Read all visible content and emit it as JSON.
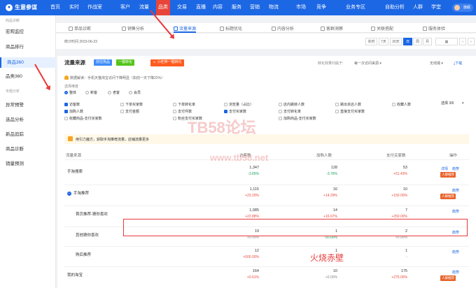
{
  "topnav": {
    "logo": "生意参谋",
    "items": [
      "首页",
      "实时",
      "作战室",
      "客户",
      "流量",
      "品类",
      "交易",
      "直播",
      "内容",
      "服务",
      "营销",
      "物流",
      "市场",
      "竞争",
      "业务专区",
      "自助分析",
      "人群",
      "学堂"
    ],
    "active": "品类",
    "user": "旗舰"
  },
  "sidebar": {
    "group1": "商品诊断",
    "items1": [
      "宏观监控",
      "商品排行",
      "商品360",
      "品类360"
    ],
    "active": "商品360",
    "group2": "专题分析",
    "items2": [
      "异常预警",
      "选品分析",
      "新品追踪",
      "商品诊断",
      "销量预测"
    ]
  },
  "tabs": [
    "单品诊断",
    "销售分析",
    "流量来源",
    "标题优化",
    "内容分析",
    "客群洞察",
    "关联搭配",
    "服务体验"
  ],
  "active_tab": "流量来源",
  "statbar": {
    "time": "统计时间 2023-06-23",
    "periods": [
      "实时",
      "7天",
      "30天",
      "日",
      "周",
      "月"
    ],
    "active_period": "日"
  },
  "section": {
    "title": "流量来源",
    "btn_blue": "前往热品",
    "btn_green": "一键转化",
    "btn_orange": "小旺神一键转化",
    "effect_label": "转化效果归属于:",
    "effect_value": "每一次访问来源",
    "device": "无线端",
    "download": "下载"
  },
  "notice": "数据解读：手机天猫淘宝访问下降明显（如前一天下降22%）",
  "dimension_label": "选择维度",
  "dimension_options": [
    "整体",
    "新客",
    "老客",
    "会员"
  ],
  "dimension_selected": "整体",
  "metrics_select_count": "选择 3/6",
  "metrics": [
    {
      "label": "访客数",
      "on": true
    },
    {
      "label": "下单买家数",
      "on": false
    },
    {
      "label": "下单转化率",
      "on": false
    },
    {
      "label": "浏览量（占比）",
      "on": false
    },
    {
      "label": "店内跳转人数",
      "on": false
    },
    {
      "label": "跳出本店人数",
      "on": false
    },
    {
      "label": "收藏人数",
      "on": false
    },
    {
      "label": "加购人数",
      "on": true
    },
    {
      "label": "支付金额",
      "on": false
    },
    {
      "label": "支付件数",
      "on": false
    },
    {
      "label": "支付买家数",
      "on": true
    },
    {
      "label": "支付转化率",
      "on": false
    },
    {
      "label": "直接支付买家数",
      "on": false
    },
    {
      "label": "收藏商品-支付买家数",
      "on": false
    },
    {
      "label": "粉丝支付买家数",
      "on": false
    },
    {
      "label": "加购商品-支付买家数",
      "on": false
    }
  ],
  "banner": "用引力魔方，获取手淘推荐流量，店铺流量更多",
  "table": {
    "headers": [
      "流量来源",
      "访客数",
      "加购人数",
      "支付买家数",
      "操作"
    ],
    "rows": [
      {
        "name": "手淘搜索",
        "v1": "1,347",
        "c1": "-3.65%",
        "v2": "128",
        "c2": "-3.76%",
        "v3": "53",
        "c3": "+51.43%",
        "act1": "详情",
        "act2": "趋势",
        "badge": "人群推荐"
      },
      {
        "name": "手淘推荐",
        "v1": "1,115",
        "c1": "+23.20%",
        "v2": "16",
        "c2": "+14.29%",
        "v3": "10",
        "c3": "+150.00%",
        "act1": "",
        "act2": "趋势",
        "badge": "人群推荐"
      },
      {
        "name": "首页推荐-猜你喜欢",
        "v1": "1,085",
        "c1": "+22.88%",
        "v2": "14",
        "c2": "+16.67%",
        "v3": "7",
        "c3": "+250.00%",
        "act1": "",
        "act2": "趋势",
        "badge": ""
      },
      {
        "name": "其他猜你喜欢",
        "v1": "19",
        "c1": "+0.00%",
        "v2": "1",
        "c2": "-50.00%",
        "v3": "2",
        "c3": "+0.00%",
        "act1": "",
        "act2": "趋势",
        "badge": ""
      },
      {
        "name": "购后推荐",
        "v1": "12",
        "c1": "+500.00%",
        "v2": "1",
        "c2": "-",
        "v3": "1",
        "c3": "-",
        "act1": "",
        "act2": "趋势",
        "badge": ""
      },
      {
        "name": "我的淘宝",
        "v1": "164",
        "c1": "+0.61%",
        "v2": "10",
        "c2": "+0.00%",
        "v3": "175",
        "c3": "+275.00%",
        "act1": "",
        "act2": "趋势",
        "badge": "人群推荐"
      }
    ]
  },
  "watermark_logo": "TB58论坛",
  "watermark_url": "www.tb58.net",
  "annotation": "火烧赤壁"
}
